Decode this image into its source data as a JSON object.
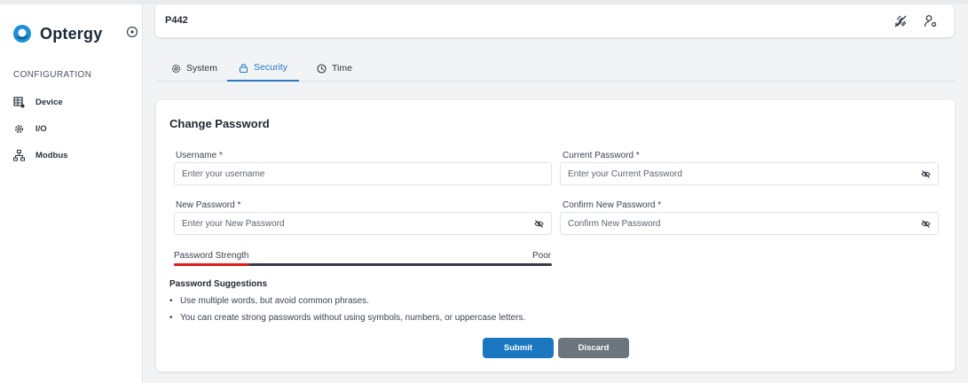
{
  "app": {
    "name": "Optergy",
    "accent": "#2a7bc4"
  },
  "sidebar": {
    "section_label": "CONFIGURATION",
    "items": [
      {
        "label": "Device",
        "icon": "device-grid-icon"
      },
      {
        "label": "I/O",
        "icon": "gear-cog-icon"
      },
      {
        "label": "Modbus",
        "icon": "network-icon"
      }
    ]
  },
  "header": {
    "title": "P442",
    "icons": [
      "disconnected-plug-icon",
      "user-settings-icon"
    ]
  },
  "tabs": [
    {
      "label": "System",
      "icon": "gear-icon",
      "active": false
    },
    {
      "label": "Security",
      "icon": "lock-icon",
      "active": true
    },
    {
      "label": "Time",
      "icon": "clock-icon",
      "active": false
    }
  ],
  "form": {
    "title": "Change Password",
    "username": {
      "label": "Username *",
      "placeholder": "Enter your username",
      "value": ""
    },
    "current_password": {
      "label": "Current Password *",
      "placeholder": "Enter your Current Password",
      "value": ""
    },
    "new_password": {
      "label": "New Password *",
      "placeholder": "Enter your New Password",
      "value": ""
    },
    "confirm_password": {
      "label": "Confirm New Password *",
      "placeholder": "Confirm New Password",
      "value": ""
    },
    "strength": {
      "label": "Password Strength",
      "value_text": "Poor",
      "level_fraction": 0.2,
      "fill_color": "#e21b1b"
    },
    "suggestions": {
      "title": "Password Suggestions",
      "items": [
        "Use multiple words, but avoid common phrases.",
        "You can create strong passwords without using symbols, numbers, or uppercase letters."
      ]
    },
    "submit_label": "Submit",
    "discard_label": "Discard",
    "submit_color": "#1a76bf",
    "discard_color": "#6c757d"
  }
}
